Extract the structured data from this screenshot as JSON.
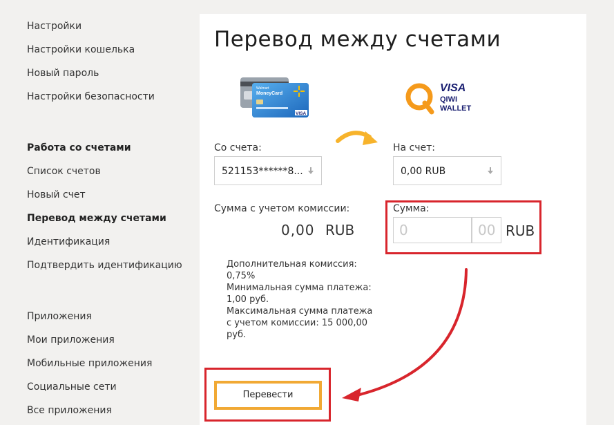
{
  "sidebar": {
    "items": [
      {
        "label": "Настройки"
      },
      {
        "label": "Настройки кошелька"
      },
      {
        "label": "Новый пароль"
      },
      {
        "label": "Настройки безопасности"
      },
      {
        "label": "Работа со счетами"
      },
      {
        "label": "Список счетов"
      },
      {
        "label": "Новый счет"
      },
      {
        "label": "Перевод между счетами"
      },
      {
        "label": "Идентификация"
      },
      {
        "label": "Подтвердить идентификацию"
      },
      {
        "label": "Приложения"
      },
      {
        "label": "Мои приложения"
      },
      {
        "label": "Мобильные приложения"
      },
      {
        "label": "Социальные сети"
      },
      {
        "label": "Все приложения"
      }
    ]
  },
  "main": {
    "title": "Перевод между счетами",
    "from": {
      "label": "Со счета:",
      "value": "521153******8..."
    },
    "to": {
      "label": "На счет:",
      "value": "0,00 RUB"
    },
    "total": {
      "label": "Сумма с учетом комиссии:",
      "amount": "0,00",
      "currency": "RUB"
    },
    "amount": {
      "label": "Сумма:",
      "rub_placeholder": "0",
      "kop_placeholder": "00",
      "currency": "RUB"
    },
    "info_lines": [
      "Дополнительная комиссия:",
      "0,75%",
      "Минимальная сумма платежа:",
      "1,00 руб.",
      "Максимальная сумма платежа",
      "с учетом комиссии: 15 000,00",
      "руб."
    ],
    "submit_label": "Перевести",
    "card_brand": {
      "top": "Walmart",
      "name": "MoneyCard",
      "visa": "VISA"
    },
    "qiwi_brand": {
      "visa": "VISA",
      "line1": "QIWI",
      "line2": "WALLET"
    }
  },
  "colors": {
    "highlight_red": "#d8252c",
    "button_orange": "#f1a934",
    "qiwi_orange": "#f59a1b",
    "visa_blue": "#1a1f71"
  }
}
